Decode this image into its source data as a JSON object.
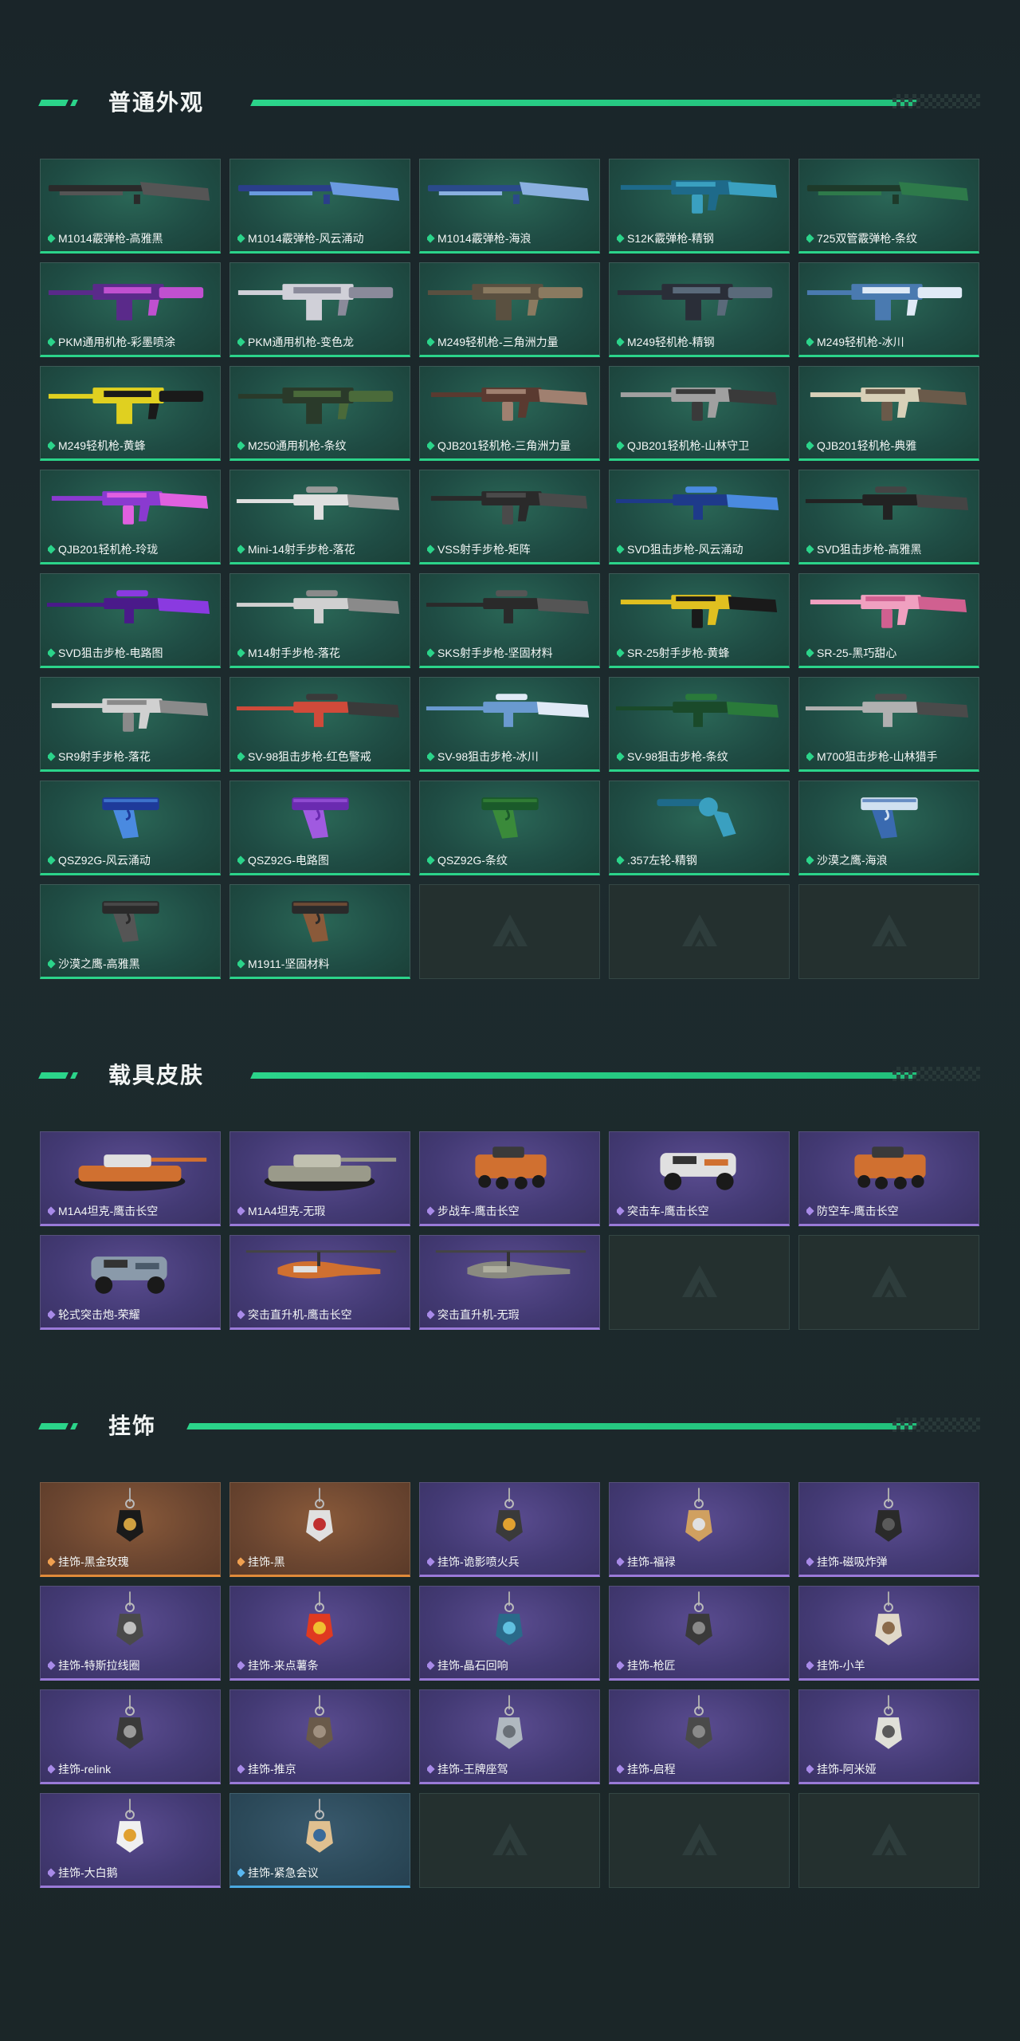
{
  "sections": [
    {
      "title": "普通外观",
      "items": [
        {
          "label": "M1014霰弹枪-高雅黑",
          "rarity": "green",
          "kind": "shotgun",
          "c1": "#2a2a2a",
          "c2": "#555"
        },
        {
          "label": "M1014霰弹枪-风云涌动",
          "rarity": "green",
          "kind": "shotgun",
          "c1": "#2a3e8a",
          "c2": "#6a9ae0"
        },
        {
          "label": "M1014霰弹枪-海浪",
          "rarity": "green",
          "kind": "shotgun",
          "c1": "#2a4a8a",
          "c2": "#8ab0e0"
        },
        {
          "label": "S12K霰弹枪-精钢",
          "rarity": "green",
          "kind": "rifle",
          "c1": "#1e6a8a",
          "c2": "#3aa0c0"
        },
        {
          "label": "725双管霰弹枪-条纹",
          "rarity": "green",
          "kind": "shotgun",
          "c1": "#1e3a2a",
          "c2": "#2e7a4a"
        },
        {
          "label": "PKM通用机枪-彩墨喷涂",
          "rarity": "green",
          "kind": "lmg",
          "c1": "#5a2a8a",
          "c2": "#c050d0"
        },
        {
          "label": "PKM通用机枪-变色龙",
          "rarity": "green",
          "kind": "lmg",
          "c1": "#d0d0d8",
          "c2": "#8a8a9a"
        },
        {
          "label": "M249轻机枪-三角洲力量",
          "rarity": "green",
          "kind": "lmg",
          "c1": "#5a5040",
          "c2": "#8a7a60"
        },
        {
          "label": "M249轻机枪-精钢",
          "rarity": "green",
          "kind": "lmg",
          "c1": "#2a2e38",
          "c2": "#5a6a7a"
        },
        {
          "label": "M249轻机枪-冰川",
          "rarity": "green",
          "kind": "lmg",
          "c1": "#4a7ab0",
          "c2": "#e0eaf6"
        },
        {
          "label": "M249轻机枪-黄蜂",
          "rarity": "green",
          "kind": "lmg",
          "c1": "#e0d020",
          "c2": "#1a1a1a"
        },
        {
          "label": "M250通用机枪-条纹",
          "rarity": "green",
          "kind": "lmg",
          "c1": "#2a3a2a",
          "c2": "#4a6a3a"
        },
        {
          "label": "QJB201轻机枪-三角洲力量",
          "rarity": "green",
          "kind": "rifle",
          "c1": "#5a3a30",
          "c2": "#a08070"
        },
        {
          "label": "QJB201轻机枪-山林守卫",
          "rarity": "green",
          "kind": "rifle",
          "c1": "#a0a0a0",
          "c2": "#3a3a3a"
        },
        {
          "label": "QJB201轻机枪-典雅",
          "rarity": "green",
          "kind": "rifle",
          "c1": "#d8d0b8",
          "c2": "#6a5a4a"
        },
        {
          "label": "QJB201轻机枪-玲珑",
          "rarity": "green",
          "kind": "rifle",
          "c1": "#8a3ad0",
          "c2": "#e060e0"
        },
        {
          "label": "Mini-14射手步枪-落花",
          "rarity": "green",
          "kind": "sniper",
          "c1": "#e0e0e0",
          "c2": "#9a9a9a"
        },
        {
          "label": "VSS射手步枪-矩阵",
          "rarity": "green",
          "kind": "rifle",
          "c1": "#2a2a2a",
          "c2": "#4a4a4a"
        },
        {
          "label": "SVD狙击步枪-风云涌动",
          "rarity": "green",
          "kind": "sniper",
          "c1": "#1e3a8a",
          "c2": "#4a8ae0"
        },
        {
          "label": "SVD狙击步枪-高雅黑",
          "rarity": "green",
          "kind": "sniper",
          "c1": "#222",
          "c2": "#444"
        },
        {
          "label": "SVD狙击步枪-电路图",
          "rarity": "green",
          "kind": "sniper",
          "c1": "#4a1a8a",
          "c2": "#8a3ae0"
        },
        {
          "label": "M14射手步枪-落花",
          "rarity": "green",
          "kind": "sniper",
          "c1": "#d0d0d0",
          "c2": "#8a8a8a"
        },
        {
          "label": "SKS射手步枪-坚固材料",
          "rarity": "green",
          "kind": "sniper",
          "c1": "#2a2a2a",
          "c2": "#555"
        },
        {
          "label": "SR-25射手步枪-黄蜂",
          "rarity": "green",
          "kind": "rifle",
          "c1": "#e0c020",
          "c2": "#1a1a1a"
        },
        {
          "label": "SR-25-黑巧甜心",
          "rarity": "green",
          "kind": "rifle",
          "c1": "#f0a0c0",
          "c2": "#d06090"
        },
        {
          "label": "SR9射手步枪-落花",
          "rarity": "green",
          "kind": "rifle",
          "c1": "#d0d0d0",
          "c2": "#8a8a8a"
        },
        {
          "label": "SV-98狙击步枪-红色警戒",
          "rarity": "green",
          "kind": "sniper",
          "c1": "#d04a3a",
          "c2": "#3a3a3a"
        },
        {
          "label": "SV-98狙击步枪-冰川",
          "rarity": "green",
          "kind": "sniper",
          "c1": "#6a9ad0",
          "c2": "#e0eaf6"
        },
        {
          "label": "SV-98狙击步枪-条纹",
          "rarity": "green",
          "kind": "sniper",
          "c1": "#1a4a2a",
          "c2": "#2a7a3a"
        },
        {
          "label": "M700狙击步枪-山林猎手",
          "rarity": "green",
          "kind": "sniper",
          "c1": "#b0b0b0",
          "c2": "#4a4a4a"
        },
        {
          "label": "QSZ92G-风云涌动",
          "rarity": "green",
          "kind": "pistol",
          "c1": "#1e3a9a",
          "c2": "#4a8ae0"
        },
        {
          "label": "QSZ92G-电路图",
          "rarity": "green",
          "kind": "pistol",
          "c1": "#6a2ab0",
          "c2": "#a05ae0"
        },
        {
          "label": "QSZ92G-条纹",
          "rarity": "green",
          "kind": "pistol",
          "c1": "#1a5a2a",
          "c2": "#3a8a3a"
        },
        {
          "label": ".357左轮-精钢",
          "rarity": "green",
          "kind": "revolver",
          "c1": "#1e6a8a",
          "c2": "#3aa0c0"
        },
        {
          "label": "沙漠之鹰-海浪",
          "rarity": "green",
          "kind": "pistol",
          "c1": "#d0e0f0",
          "c2": "#3a6ab0"
        },
        {
          "label": "沙漠之鹰-高雅黑",
          "rarity": "green",
          "kind": "pistol",
          "c1": "#2a2a2a",
          "c2": "#555"
        },
        {
          "label": "M1911-坚固材料",
          "rarity": "green",
          "kind": "pistol",
          "c1": "#2a2a2a",
          "c2": "#8a5a3a"
        },
        {
          "label": "",
          "rarity": "empty"
        },
        {
          "label": "",
          "rarity": "empty"
        },
        {
          "label": "",
          "rarity": "empty"
        }
      ]
    },
    {
      "title": "载具皮肤",
      "items": [
        {
          "label": "M1A4坦克-鹰击长空",
          "rarity": "purple",
          "kind": "tank",
          "c1": "#d07030",
          "c2": "#e0e0e0"
        },
        {
          "label": "M1A4坦克-无瑕",
          "rarity": "purple",
          "kind": "tank",
          "c1": "#9a9a8a",
          "c2": "#c0c0b0"
        },
        {
          "label": "步战车-鹰击长空",
          "rarity": "purple",
          "kind": "ifv",
          "c1": "#d07030",
          "c2": "#3a3a3a"
        },
        {
          "label": "突击车-鹰击长空",
          "rarity": "purple",
          "kind": "buggy",
          "c1": "#e0e0e0",
          "c2": "#d07030"
        },
        {
          "label": "防空车-鹰击长空",
          "rarity": "purple",
          "kind": "ifv",
          "c1": "#d07030",
          "c2": "#3a3a3a"
        },
        {
          "label": "轮式突击炮-荣耀",
          "rarity": "purple",
          "kind": "buggy",
          "c1": "#8a9aaa",
          "c2": "#4a5a6a"
        },
        {
          "label": "突击直升机-鹰击长空",
          "rarity": "purple",
          "kind": "heli",
          "c1": "#d07030",
          "c2": "#e0e0e0"
        },
        {
          "label": "突击直升机-无瑕",
          "rarity": "purple",
          "kind": "heli",
          "c1": "#8a8a80",
          "c2": "#b0b0a0"
        },
        {
          "label": "",
          "rarity": "empty"
        },
        {
          "label": "",
          "rarity": "empty"
        }
      ]
    },
    {
      "title": "挂饰",
      "items": [
        {
          "label": "挂饰-黑金玫瑰",
          "rarity": "orange",
          "kind": "charm",
          "c1": "#1a1a1a",
          "c2": "#d0a040"
        },
        {
          "label": "挂饰-黑",
          "rarity": "orange",
          "kind": "charm",
          "c1": "#e0e0e0",
          "c2": "#c03030"
        },
        {
          "label": "挂饰-诡影喷火兵",
          "rarity": "purple",
          "kind": "charm",
          "c1": "#3a3a3a",
          "c2": "#e0a030"
        },
        {
          "label": "挂饰-福禄",
          "rarity": "purple",
          "kind": "charm",
          "c1": "#d0a060",
          "c2": "#e0e0e0"
        },
        {
          "label": "挂饰-磁吸炸弹",
          "rarity": "purple",
          "kind": "charm",
          "c1": "#2a2a2a",
          "c2": "#5a5a5a"
        },
        {
          "label": "挂饰-特斯拉线圈",
          "rarity": "purple",
          "kind": "charm",
          "c1": "#4a4a4a",
          "c2": "#c0c0c0"
        },
        {
          "label": "挂饰-来点薯条",
          "rarity": "purple",
          "kind": "charm",
          "c1": "#e03a20",
          "c2": "#f0c030"
        },
        {
          "label": "挂饰-晶石回响",
          "rarity": "purple",
          "kind": "charm",
          "c1": "#2a6a8a",
          "c2": "#60c0e0"
        },
        {
          "label": "挂饰-枪匠",
          "rarity": "purple",
          "kind": "charm",
          "c1": "#3a3a3a",
          "c2": "#8a8a8a"
        },
        {
          "label": "挂饰-小羊",
          "rarity": "purple",
          "kind": "charm",
          "c1": "#e0d8c8",
          "c2": "#8a6a4a"
        },
        {
          "label": "挂饰-relink",
          "rarity": "purple",
          "kind": "charm",
          "c1": "#3a3a3a",
          "c2": "#9a9a9a"
        },
        {
          "label": "挂饰-推京",
          "rarity": "purple",
          "kind": "charm",
          "c1": "#6a5a4a",
          "c2": "#a09080"
        },
        {
          "label": "挂饰-王牌座驾",
          "rarity": "purple",
          "kind": "charm",
          "c1": "#b0b8c0",
          "c2": "#6a7078"
        },
        {
          "label": "挂饰-启程",
          "rarity": "purple",
          "kind": "charm",
          "c1": "#4a4a4a",
          "c2": "#8a8a8a"
        },
        {
          "label": "挂饰-阿米娅",
          "rarity": "purple",
          "kind": "charm",
          "c1": "#e0e0d8",
          "c2": "#5a5a5a"
        },
        {
          "label": "挂饰-大白鹅",
          "rarity": "purple",
          "kind": "charm",
          "c1": "#f0f0f0",
          "c2": "#e0a030"
        },
        {
          "label": "挂饰-紧急会议",
          "rarity": "blue",
          "kind": "charm",
          "c1": "#e0c090",
          "c2": "#3a6a9a"
        },
        {
          "label": "",
          "rarity": "empty"
        },
        {
          "label": "",
          "rarity": "empty"
        },
        {
          "label": "",
          "rarity": "empty"
        }
      ]
    }
  ]
}
